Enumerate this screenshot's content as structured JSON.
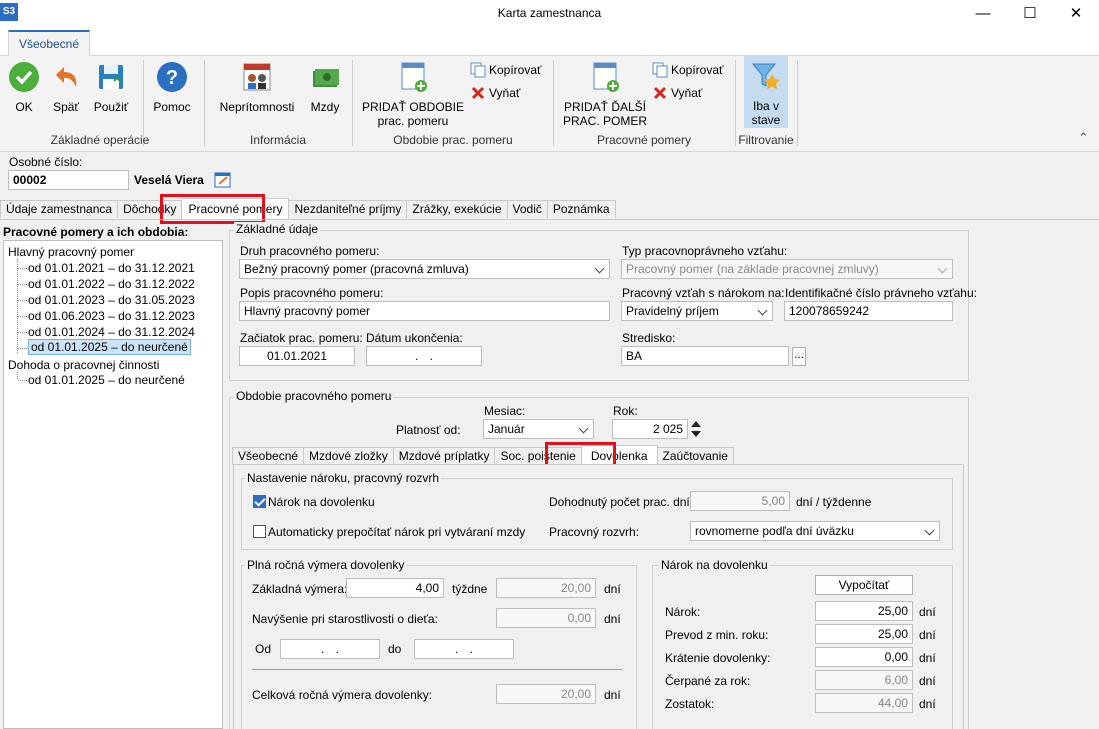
{
  "window": {
    "title": "Karta zamestnanca",
    "app_logo": "S3",
    "minimize": "—",
    "maximize": "☐",
    "close": "✕"
  },
  "ribbon": {
    "tab": "Všeobecné",
    "buttons": {
      "ok": "OK",
      "spat": "Späť",
      "pouzit": "Použiť",
      "pomoc": "Pomoc",
      "nepritomnosti": "Neprítomnosti",
      "mzdy": "Mzdy",
      "pridat_obdobie_1": "PRIDAŤ OBDOBIE",
      "pridat_obdobie_2": "prac. pomeru",
      "kopirovat": "Kopírovať",
      "vyniat": "Vyňať",
      "pridat_dalsi_1": "PRIDAŤ ĎALŠÍ",
      "pridat_dalsi_2": "PRAC. POMER",
      "kopirovat2": "Kopírovať",
      "vyniat2": "Vyňať",
      "iba_v_1": "Iba v",
      "iba_v_2": "stave"
    },
    "groups": {
      "zakladne": "Základné operácie",
      "informacia": "Informácia",
      "obdobie": "Obdobie prac. pomeru",
      "pracovne": "Pracovné pomery",
      "filtrovanie": "Filtrovanie"
    },
    "collapse": "⌃"
  },
  "employee": {
    "osobne_cislo_label": "Osobné číslo:",
    "osobne_cislo": "00002",
    "name": "Veselá Viera"
  },
  "main_tabs": [
    "Údaje zamestnanca",
    "Dôchodky",
    "Pracovné pomery",
    "Nezdaniteľné príjmy",
    "Zrážky, exekúcie",
    "Vodič",
    "Poznámka"
  ],
  "tree": {
    "title": "Pracovné pomery a ich obdobia:",
    "items": [
      "Hlavný pracovný pomer",
      "od 01.01.2021 – do 31.12.2021",
      "od 01.01.2022 – do 31.12.2022",
      "od 01.01.2023 – do 31.05.2023",
      "od 01.06.2023 – do 31.12.2023",
      "od 01.01.2024 – do 31.12.2024",
      "od 01.01.2025 – do neurčené",
      "Dohoda o pracovnej činnosti",
      "od 01.01.2025 – do neurčené"
    ]
  },
  "zakladne": {
    "title": "Základné údaje",
    "druh_label": "Druh pracovného pomeru:",
    "druh": "Bežný pracovný pomer (pracovná zmluva)",
    "typ_label": "Typ pracovnoprávneho vzťahu:",
    "typ": "Pracovný pomer (na základe pracovnej zmluvy)",
    "popis_label": "Popis pracovného pomeru:",
    "popis": "Hlavný pracovný pomer",
    "vztah_label": "Pracovný vzťah s nárokom na:",
    "vztah": "Pravidelný príjem",
    "ident_label": "Identifikačné číslo právneho vzťahu:",
    "ident": "120078659242",
    "zaciatok_label": "Začiatok prac. pomeru:",
    "zaciatok": "01.01.2021",
    "ukoncenie_label": "Dátum ukončenia:",
    "ukoncenie": ". .",
    "stredisko_label": "Stredisko:",
    "stredisko": "BA",
    "stredisko_btn": "..."
  },
  "obdobie": {
    "title": "Obdobie pracovného pomeru",
    "platnost_label": "Platnosť od:",
    "mesiac_label": "Mesiac:",
    "mesiac": "Január",
    "rok_label": "Rok:",
    "rok": "2 025"
  },
  "sub_tabs": [
    "Všeobecné",
    "Mzdové zložky",
    "Mzdové príplatky",
    "Soc. poistenie",
    "Dovolenka",
    "Zaúčtovanie"
  ],
  "dovolenka": {
    "nastavenie_title": "Nastavenie nároku, pracovný rozvrh",
    "narok_chk": "Nárok na dovolenku",
    "auto_chk": "Automaticky prepočítať nárok pri vytváraní mzdy",
    "dohodnuty_label": "Dohodnutý počet prac. dní:",
    "dohodnuty": "5,00",
    "dohodnuty_unit": "dní / týždenne",
    "rozvrh_label": "Pracovný rozvrh:",
    "rozvrh": "rovnomerne podľa dní úväzku",
    "plna_title": "Plná ročná výmera dovolenky",
    "zakladna_label": "Základná výmera:",
    "zakladna": "4,00",
    "zakladna_unit": "týždne",
    "zakladna_dni": "20,00",
    "dni": "dní",
    "navysenie_label": "Navýšenie pri starostlivosti o dieťa:",
    "navysenie": "0,00",
    "od_label": "Od",
    "od": ". .",
    "do_label": "do",
    "do": ". .",
    "celkova_label": "Celková ročná výmera dovolenky:",
    "celkova": "20,00",
    "narok_title": "Nárok na dovolenku",
    "vypocitat": "Vypočítať",
    "narok_label": "Nárok:",
    "narok": "25,00",
    "prevod_label": "Prevod z min. roku:",
    "prevod": "25,00",
    "kratenie_label": "Krátenie dovolenky:",
    "kratenie": "0,00",
    "cerpane_label": "Čerpané za rok:",
    "cerpane": "6,00",
    "zostatok_label": "Zostatok:",
    "zostatok": "44,00"
  }
}
